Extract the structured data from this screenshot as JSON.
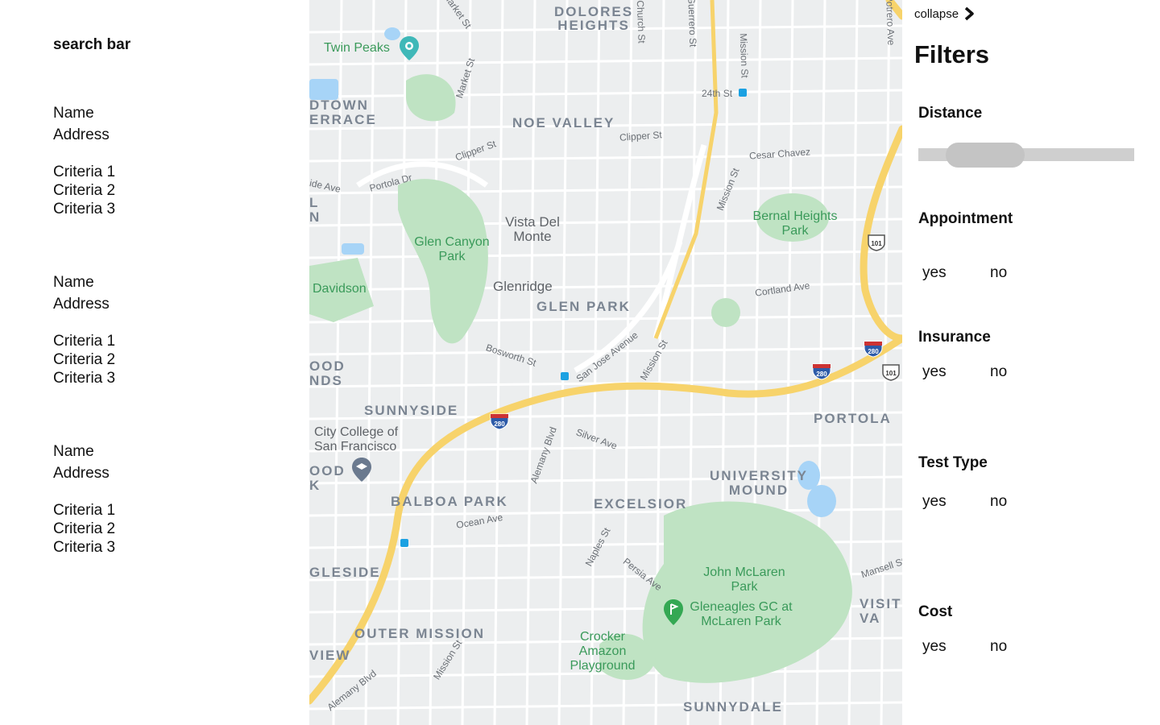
{
  "left_panel": {
    "search_bar_label": "search bar",
    "results": [
      {
        "name": "Name",
        "address": "Address",
        "criteria": [
          "Criteria 1",
          "Criteria 2",
          "Criteria 3"
        ]
      },
      {
        "name": "Name",
        "address": "Address",
        "criteria": [
          "Criteria 1",
          "Criteria 2",
          "Criteria 3"
        ]
      },
      {
        "name": "Name",
        "address": "Address",
        "criteria": [
          "Criteria 1",
          "Criteria 2",
          "Criteria 3"
        ]
      }
    ]
  },
  "map": {
    "neighborhoods": {
      "dolores_heights": "DOLORES HEIGHTS",
      "noe_valley": "NOE VALLEY",
      "glen_park": "GLEN PARK",
      "sunnyside": "SUNNYSIDE",
      "portola": "PORTOLA",
      "university_mound": "UNIVERSITY MOUND",
      "excelsior": "EXCELSIOR",
      "balboa_park": "BALBOA PARK",
      "outer_mission": "OUTER MISSION",
      "sunnydale": "SUNNYDALE",
      "midtown_terrace": "DTOWN ERRACE",
      "ingleside": "GLESIDE",
      "westwood": "OOD NDS",
      "visitacion": "VISIT VA",
      "view": "VIEW",
      "ood_k": "OOD K",
      "l_n": "L N"
    },
    "parks": {
      "twin_peaks": "Twin Peaks",
      "glen_canyon": "Glen Canyon Park",
      "bernal": "Bernal Heights Park",
      "john_mclaren": "John McLaren Park",
      "gleneagles": "Gleneagles GC at McLaren Park",
      "crocker": "Crocker Amazon Playground",
      "davidson": "Davidson"
    },
    "places": {
      "vista_del_monte": "Vista Del Monte",
      "glenridge": "Glenridge",
      "city_college": "City College of San Francisco"
    },
    "streets": {
      "market1": "Market St",
      "market2": "Market St",
      "church": "Church St",
      "guerrero": "Guerrero St",
      "mission_top": "Mission St",
      "potrero": "Potrero Ave",
      "st24": "24th St",
      "clipper1": "Clipper St",
      "clipper2": "Clipper St",
      "cesar": "Cesar Chavez",
      "portola_dr": "Portola Dr",
      "mission_mid": "Mission St",
      "cortland": "Cortland Ave",
      "bosworth": "Bosworth St",
      "san_jose": "San Jose Avenue",
      "mission_low": "Mission St",
      "alemany1": "Alemany Blvd",
      "silver": "Silver Ave",
      "ocean": "Ocean Ave",
      "naples": "Naples St",
      "persia": "Persia Ave",
      "mansell": "Mansell St",
      "mission_bot": "Mission St",
      "alemany2": "Alemany Blvd",
      "ide_ave": "ide Ave"
    },
    "highways": {
      "i280": "280",
      "us101": "101"
    },
    "colors": {
      "freeway": "#f7d36b",
      "park": "#bfe3c3",
      "water": "#a7d4f7",
      "land": "#eceeef"
    }
  },
  "filters": {
    "collapse_label": "collapse",
    "title": "Filters",
    "distance": {
      "label": "Distance",
      "value_fraction": 0.2
    },
    "groups": [
      {
        "label": "Appointment",
        "yes": "yes",
        "no": "no"
      },
      {
        "label": "Insurance",
        "yes": "yes",
        "no": "no"
      },
      {
        "label": "Test Type",
        "yes": "yes",
        "no": "no"
      },
      {
        "label": "Cost",
        "yes": "yes",
        "no": "no"
      }
    ]
  }
}
